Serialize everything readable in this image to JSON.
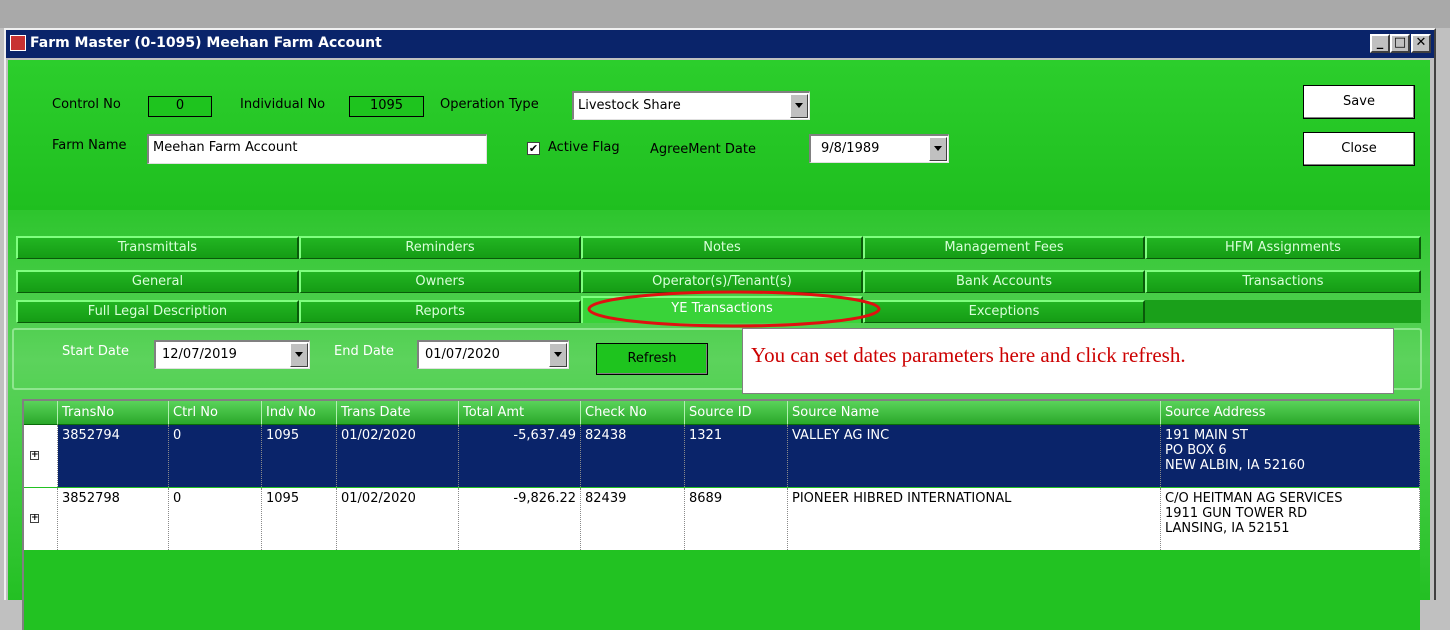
{
  "window": {
    "title": "Farm Master (0-1095) Meehan Farm Account",
    "min_label": "_",
    "max_label": "□",
    "close_label": "✕"
  },
  "header": {
    "control_no_label": "Control No",
    "control_no_value": "0",
    "individual_no_label": "Individual No",
    "individual_no_value": "1095",
    "operation_type_label": "Operation Type",
    "operation_type_value": "Livestock Share",
    "farm_name_label": "Farm Name",
    "farm_name_value": "Meehan Farm Account",
    "active_flag_label": "Active Flag",
    "active_flag_check": "✔",
    "agreement_date_label": "AgreeMent Date",
    "agreement_date_value": "9/8/1989",
    "save_label": "Save",
    "close_label": "Close"
  },
  "tabs": {
    "row1": [
      "Transmittals",
      "Reminders",
      "Notes",
      "Management Fees",
      "HFM Assignments"
    ],
    "row2": [
      "General",
      "Owners",
      "Operator(s)/Tenant(s)",
      "Bank Accounts",
      "Transactions"
    ],
    "row3": [
      "Full Legal Description",
      "Reports",
      "YE Transactions",
      "Exceptions"
    ]
  },
  "filters": {
    "start_date_label": "Start Date",
    "start_date_value": "12/07/2019",
    "end_date_label": "End Date",
    "end_date_value": "01/07/2020",
    "refresh_label": "Refresh"
  },
  "callout": "You can set dates parameters here and click refresh.",
  "grid": {
    "columns": [
      "TransNo",
      "Ctrl No",
      "Indv No",
      "Trans Date",
      "Total Amt",
      "Check No",
      "Source ID",
      "Source Name",
      "Source Address"
    ],
    "rows": [
      {
        "trans_no": "3852794",
        "ctrl_no": "0",
        "indv_no": "1095",
        "trans_date": "01/02/2020",
        "total_amt": "-5,637.49",
        "check_no": "82438",
        "source_id": "1321",
        "source_name": "VALLEY AG INC",
        "address1": "191 MAIN ST",
        "address2": "PO BOX 6",
        "address3": "NEW ALBIN, IA 52160"
      },
      {
        "trans_no": "3852798",
        "ctrl_no": "0",
        "indv_no": "1095",
        "trans_date": "01/02/2020",
        "total_amt": "-9,826.22",
        "check_no": "82439",
        "source_id": "8689",
        "source_name": "PIONEER HIBRED INTERNATIONAL",
        "address1": "C/O HEITMAN AG SERVICES",
        "address2": "1911 GUN TOWER RD",
        "address3": "LANSING, IA 52151"
      }
    ],
    "expand_glyph": "+"
  },
  "colors": {
    "titlebar": "#0a246a",
    "form_background": "#27c327",
    "selected_row": "#0a246a",
    "callout_text": "#cc0000",
    "highlight_ellipse": "#e01010"
  }
}
